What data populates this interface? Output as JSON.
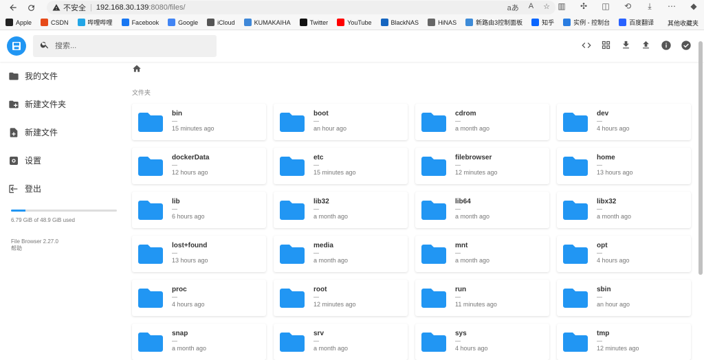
{
  "browser": {
    "security_label": "不安全",
    "url_host": "192.168.30.139",
    "url_path": ":8080/files/",
    "read_aloud": "aあ",
    "text_size": "A",
    "bookmarks": [
      {
        "label": "Apple",
        "icon": "apple-icon",
        "color": "#222222"
      },
      {
        "label": "CSDN",
        "icon": "csdn-icon",
        "color": "#e64a19"
      },
      {
        "label": "哔哩哔哩",
        "icon": "bilibili-icon",
        "color": "#23a6e6"
      },
      {
        "label": "Facebook",
        "icon": "facebook-icon",
        "color": "#1877f2"
      },
      {
        "label": "Google",
        "icon": "google-icon",
        "color": "#4285f4"
      },
      {
        "label": "iCloud",
        "icon": "icloud-icon",
        "color": "#555555"
      },
      {
        "label": "KUMAKAIHA",
        "icon": "kumakaiha-icon",
        "color": "#3f88d8"
      },
      {
        "label": "Twitter",
        "icon": "twitter-icon",
        "color": "#111111"
      },
      {
        "label": "YouTube",
        "icon": "youtube-icon",
        "color": "#ff0000"
      },
      {
        "label": "BlackNAS",
        "icon": "blacknas-icon",
        "color": "#1565c0"
      },
      {
        "label": "HiNAS",
        "icon": "hinas-icon",
        "color": "#666666"
      },
      {
        "label": "新路由3控制面板",
        "icon": "router-icon",
        "color": "#3d8bd8"
      },
      {
        "label": "知乎",
        "icon": "zhihu-icon",
        "color": "#0a66ff"
      },
      {
        "label": "实例 - 控制台",
        "icon": "cloud-icon",
        "color": "#2a7de1"
      },
      {
        "label": "百度翻译",
        "icon": "baidu-translate-icon",
        "color": "#2962ff"
      }
    ],
    "other_bookmarks": "其他收藏夹"
  },
  "app": {
    "search_placeholder": "搜索...",
    "sidebar": [
      {
        "label": "我的文件",
        "icon": "folder-icon",
        "name": "sidebar-item-my-files"
      },
      {
        "label": "新建文件夹",
        "icon": "new-folder-icon",
        "name": "sidebar-item-new-folder"
      },
      {
        "label": "新建文件",
        "icon": "new-file-icon",
        "name": "sidebar-item-new-file"
      },
      {
        "label": "设置",
        "icon": "settings-icon",
        "name": "sidebar-item-settings"
      },
      {
        "label": "登出",
        "icon": "logout-icon",
        "name": "sidebar-item-logout"
      }
    ],
    "storage": {
      "text": "6.79 GiB of 48.9 GiB used",
      "fraction": 0.139
    },
    "version": "File Browser 2.27.0",
    "help": "帮助",
    "section_title": "文件夹",
    "accent": "#2196f3"
  },
  "folders": [
    {
      "name": "bin",
      "size": "—",
      "modified": "15 minutes ago"
    },
    {
      "name": "boot",
      "size": "—",
      "modified": "an hour ago"
    },
    {
      "name": "cdrom",
      "size": "—",
      "modified": "a month ago"
    },
    {
      "name": "dev",
      "size": "—",
      "modified": "4 hours ago"
    },
    {
      "name": "dockerData",
      "size": "—",
      "modified": "12 hours ago"
    },
    {
      "name": "etc",
      "size": "—",
      "modified": "15 minutes ago"
    },
    {
      "name": "filebrowser",
      "size": "—",
      "modified": "12 minutes ago"
    },
    {
      "name": "home",
      "size": "—",
      "modified": "13 hours ago"
    },
    {
      "name": "lib",
      "size": "—",
      "modified": "6 hours ago"
    },
    {
      "name": "lib32",
      "size": "—",
      "modified": "a month ago"
    },
    {
      "name": "lib64",
      "size": "—",
      "modified": "a month ago"
    },
    {
      "name": "libx32",
      "size": "—",
      "modified": "a month ago"
    },
    {
      "name": "lost+found",
      "size": "—",
      "modified": "13 hours ago"
    },
    {
      "name": "media",
      "size": "—",
      "modified": "a month ago"
    },
    {
      "name": "mnt",
      "size": "—",
      "modified": "a month ago"
    },
    {
      "name": "opt",
      "size": "—",
      "modified": "4 hours ago"
    },
    {
      "name": "proc",
      "size": "—",
      "modified": "4 hours ago"
    },
    {
      "name": "root",
      "size": "—",
      "modified": "12 minutes ago"
    },
    {
      "name": "run",
      "size": "—",
      "modified": "11 minutes ago"
    },
    {
      "name": "sbin",
      "size": "—",
      "modified": "an hour ago"
    },
    {
      "name": "snap",
      "size": "—",
      "modified": "a month ago"
    },
    {
      "name": "srv",
      "size": "—",
      "modified": "a month ago"
    },
    {
      "name": "sys",
      "size": "—",
      "modified": "4 hours ago"
    },
    {
      "name": "tmp",
      "size": "—",
      "modified": "12 minutes ago"
    }
  ]
}
